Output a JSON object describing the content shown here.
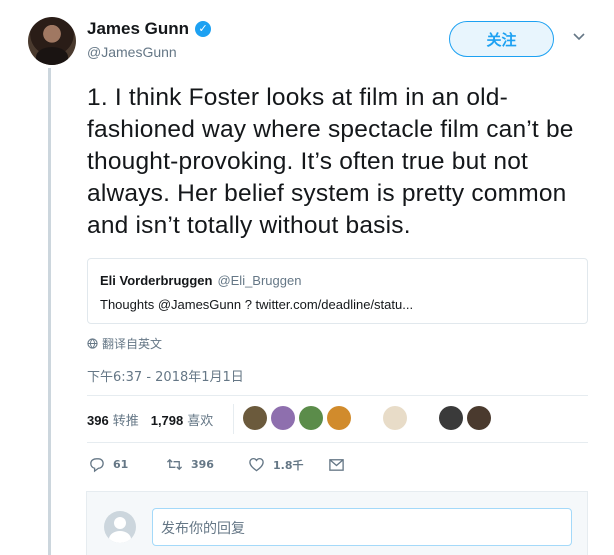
{
  "author": {
    "name": "James Gunn",
    "handle": "@JamesGunn",
    "verified_icon": "check"
  },
  "follow_button": {
    "label": "关注"
  },
  "tweet": {
    "text": "1. I think Foster looks at film in an old-fashioned way where spectacle film can’t be thought-provoking. It’s often true but not always. Her belief system is pretty common and isn’t totally without basis."
  },
  "quote": {
    "name": "Eli Vorderbruggen",
    "handle": "@Eli_Bruggen",
    "text": "Thoughts @JamesGunn ? twitter.com/deadline/statu..."
  },
  "translate": {
    "label": "翻译自英文",
    "icon": "globe-icon"
  },
  "timestamp": "下午6:37 - 2018年1月1日",
  "stats": {
    "retweets_count": "396",
    "retweets_label": "转推",
    "likes_count": "1,798",
    "likes_label": "喜欢"
  },
  "likers": [
    {
      "color": "#6b5a3c"
    },
    {
      "color": "#8e6fae"
    },
    {
      "color": "#5b8c4a"
    },
    {
      "color": "#d18b2c"
    },
    {
      "color": "#ffffff"
    },
    {
      "color": "#e8dcc8"
    },
    {
      "color": "#ffffff"
    },
    {
      "color": "#3a3a3a"
    },
    {
      "color": "#4a3a2e"
    }
  ],
  "actions": {
    "reply_count": "61",
    "retweet_count": "396",
    "like_count": "1.8千"
  },
  "reply": {
    "placeholder": "发布你的回复"
  },
  "colors": {
    "accent": "#1da1f2",
    "secondary_text": "#657786"
  }
}
